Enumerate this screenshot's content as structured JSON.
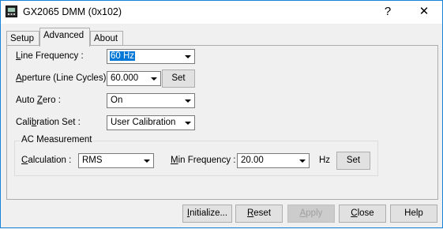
{
  "window": {
    "title": "GX2065 DMM (0x102)",
    "help_glyph": "?",
    "close_glyph": "✕"
  },
  "tabs": [
    {
      "label": "Setup",
      "active": false
    },
    {
      "label": "Advanced",
      "active": true
    },
    {
      "label": "About",
      "active": false
    }
  ],
  "advanced": {
    "line_frequency": {
      "label_u": "L",
      "label_rest": "ine Frequency :",
      "value": "60 Hz"
    },
    "aperture": {
      "label_u": "A",
      "label_rest": "perture (Line Cycles) :",
      "value": "60.000",
      "set_label": "Set"
    },
    "auto_zero": {
      "label_pre": "Auto ",
      "label_u": "Z",
      "label_rest": "ero :",
      "value": "On"
    },
    "calibration_set": {
      "label_pre": "Cali",
      "label_u": "b",
      "label_rest": "ration Set :",
      "value": "User Calibration"
    },
    "ac_measurement": {
      "title": "AC Measurement",
      "calculation": {
        "label_u": "C",
        "label_rest": "alculation :",
        "value": "RMS"
      },
      "min_frequency": {
        "label_u": "M",
        "label_rest": "in Frequency :",
        "value": "20.00",
        "unit": "Hz",
        "set_label": "Set"
      }
    }
  },
  "footer": {
    "initialize_u": "I",
    "initialize_rest": "nitialize...",
    "reset_u": "R",
    "reset_rest": "eset",
    "apply_u": "A",
    "apply_rest": "pply",
    "close_u": "C",
    "close_rest": "lose",
    "help": "Help"
  },
  "colors": {
    "accent": "#0078d7",
    "window_border": "#1883d7",
    "dialog_bg": "#f0f0f0"
  }
}
